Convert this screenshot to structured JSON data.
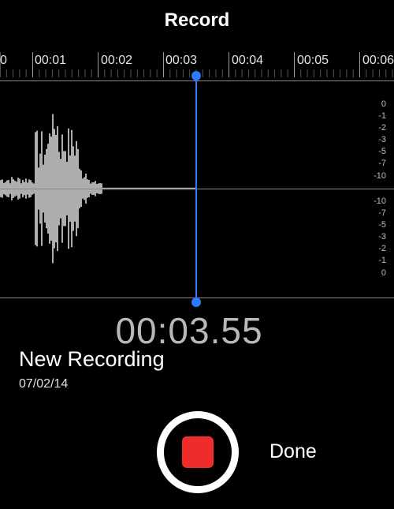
{
  "header": {
    "title": "Record"
  },
  "timeline": {
    "ticks": [
      "0",
      "00:01",
      "00:02",
      "00:03",
      "00:04",
      "00:05",
      "00:06"
    ]
  },
  "levels": {
    "top": [
      "0",
      "-1",
      "-2",
      "-3",
      "-5",
      "-7",
      "-10"
    ],
    "bottom": [
      "-10",
      "-7",
      "-5",
      "-3",
      "-2",
      "-1",
      "0"
    ]
  },
  "recording": {
    "elapsed": "00:03.55",
    "name": "New Recording",
    "date": "07/02/14"
  },
  "controls": {
    "done_label": "Done"
  },
  "colors": {
    "accent": "#2a7bff",
    "record": "#ef2b2b"
  }
}
